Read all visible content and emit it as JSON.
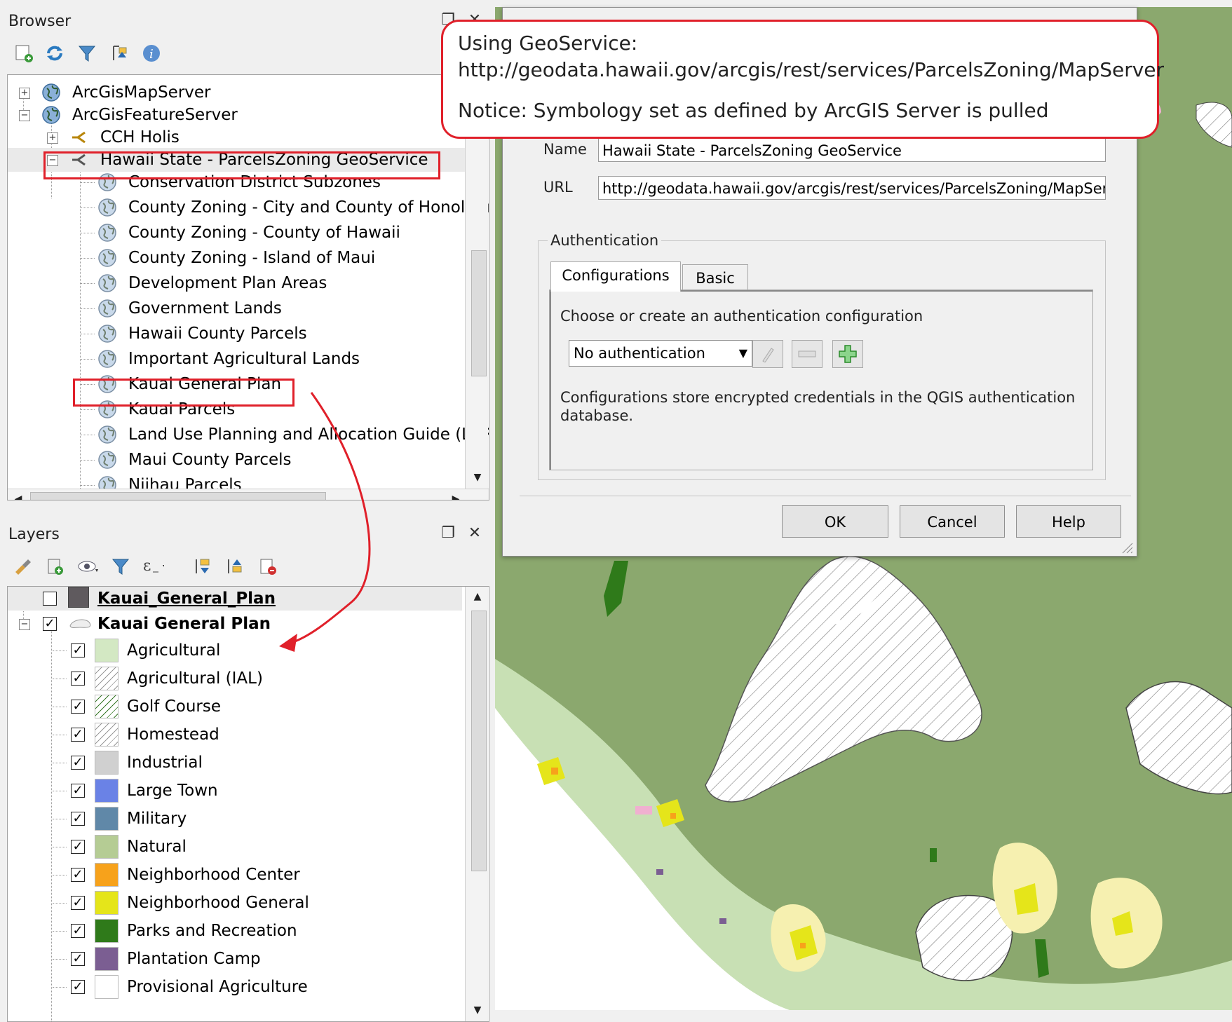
{
  "browser": {
    "title": "Browser",
    "items": [
      {
        "label": "ArcGisMapServer"
      },
      {
        "label": "ArcGisFeatureServer"
      },
      {
        "label": "CCH Holis"
      },
      {
        "label": "Hawaii State - ParcelsZoning GeoService"
      },
      {
        "label": "Conservation District Subzones"
      },
      {
        "label": "County Zoning - City and County of Honolulu"
      },
      {
        "label": "County Zoning - County of Hawaii"
      },
      {
        "label": "County Zoning - Island of Maui"
      },
      {
        "label": "Development Plan Areas"
      },
      {
        "label": "Government Lands"
      },
      {
        "label": "Hawaii County Parcels"
      },
      {
        "label": "Important Agricultural Lands"
      },
      {
        "label": "Kauai General Plan"
      },
      {
        "label": "Kauai Parcels"
      },
      {
        "label": "Land Use Planning and Allocation Guide (LUPAG)"
      },
      {
        "label": "Maui County Parcels"
      },
      {
        "label": "Niihau Parcels"
      }
    ]
  },
  "layers": {
    "title": "Layers",
    "top_layer": "Kauai_General_Plan",
    "group_layer": "Kauai General Plan",
    "legend": [
      {
        "label": "Agricultural",
        "color": "#d3e8c3",
        "pattern": "solid"
      },
      {
        "label": "Agricultural (IAL)",
        "color": "#ffffff",
        "pattern": "hatch"
      },
      {
        "label": "Golf Course",
        "color": "#ffffff",
        "pattern": "hatch-green"
      },
      {
        "label": "Homestead",
        "color": "#ffffff",
        "pattern": "hatch"
      },
      {
        "label": "Industrial",
        "color": "#d0d0d0",
        "pattern": "solid"
      },
      {
        "label": "Large Town",
        "color": "#6a82e6",
        "pattern": "solid"
      },
      {
        "label": "Military",
        "color": "#6088a8",
        "pattern": "solid"
      },
      {
        "label": "Natural",
        "color": "#b5cc94",
        "pattern": "solid"
      },
      {
        "label": "Neighborhood Center",
        "color": "#f7a21b",
        "pattern": "solid"
      },
      {
        "label": "Neighborhood General",
        "color": "#e5e51a",
        "pattern": "solid"
      },
      {
        "label": "Parks and Recreation",
        "color": "#2f7a1a",
        "pattern": "solid"
      },
      {
        "label": "Plantation Camp",
        "color": "#7b5e92",
        "pattern": "solid"
      },
      {
        "label": "Provisional Agriculture",
        "color": "#ffffff",
        "pattern": "solid"
      }
    ]
  },
  "dialog": {
    "name_label": "Name",
    "name_value": "Hawaii State - ParcelsZoning GeoService",
    "url_label": "URL",
    "url_value": "http://geodata.hawaii.gov/arcgis/rest/services/ParcelsZoning/MapServer",
    "auth_group": "Authentication",
    "tabs": [
      "Configurations",
      "Basic"
    ],
    "choose_text": "Choose or create an authentication configuration",
    "auth_select": "No authentication",
    "info_line1": "Configurations store encrypted credentials in the QGIS authentication",
    "info_line2": "database.",
    "ok": "OK",
    "cancel": "Cancel",
    "help": "Help"
  },
  "callout": {
    "line1": "Using GeoService:",
    "line2": "http://geodata.hawaii.gov/arcgis/rest/services/ParcelsZoning/MapServer",
    "line3": "Notice: Symbology set as defined by ArcGIS Server is pulled"
  },
  "colors": {
    "highlight": "#e0202a",
    "map_natural": "#8ba86e",
    "map_agricultural": "#c8e0b4"
  }
}
